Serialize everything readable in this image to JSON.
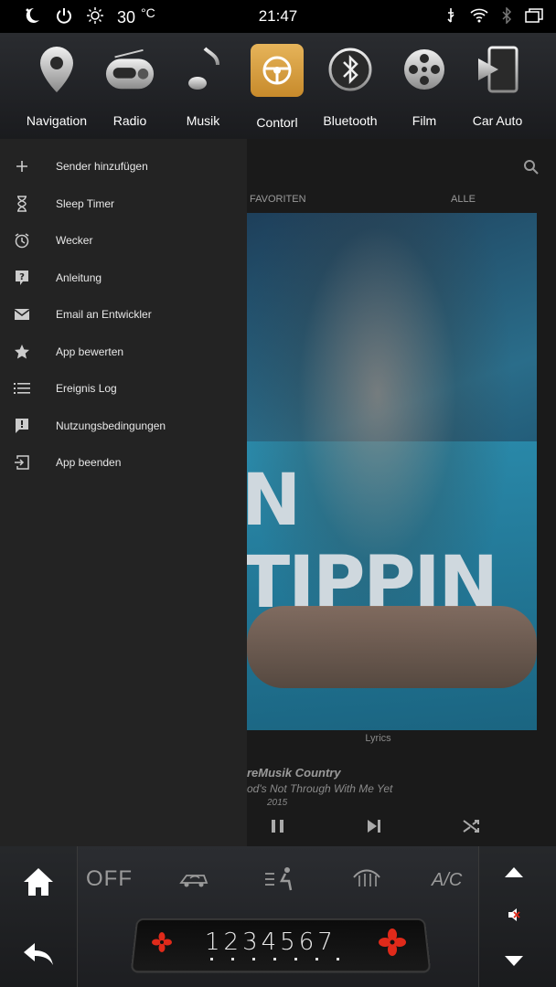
{
  "status": {
    "temperature": "30",
    "unit": "°C",
    "time": "21:47"
  },
  "dock": [
    {
      "label": "Navigation",
      "icon": "location-pin-icon"
    },
    {
      "label": "Radio",
      "icon": "radio-icon"
    },
    {
      "label": "Musik",
      "icon": "music-note-icon"
    },
    {
      "label": "Contorl",
      "icon": "steering-wheel-icon",
      "active": true
    },
    {
      "label": "Bluetooth",
      "icon": "bluetooth-icon"
    },
    {
      "label": "Film",
      "icon": "film-reel-icon"
    },
    {
      "label": "Car Auto",
      "icon": "phone-play-icon"
    }
  ],
  "tabs": {
    "favorites": "FAVORITEN",
    "all": "ALLE"
  },
  "drawer": {
    "items": [
      {
        "label": "Sender hinzufügen",
        "icon": "plus-icon"
      },
      {
        "label": "Sleep Timer",
        "icon": "hourglass-icon"
      },
      {
        "label": "Wecker",
        "icon": "alarm-icon"
      },
      {
        "label": "Anleitung",
        "icon": "help-icon"
      },
      {
        "label": "Email an Entwickler",
        "icon": "email-icon"
      },
      {
        "label": "App bewerten",
        "icon": "star-icon"
      },
      {
        "label": "Ereignis Log",
        "icon": "list-icon"
      },
      {
        "label": "Nutzungsbedingungen",
        "icon": "feedback-icon"
      },
      {
        "label": "App beenden",
        "icon": "exit-icon"
      }
    ]
  },
  "player": {
    "lyrics": "Lyrics",
    "station": "reMusik Country",
    "song": "od's Not Through With Me Yet",
    "year": "2015",
    "cover_text": "N TIPPIN"
  },
  "climate": {
    "off": "OFF",
    "ac": "A/C",
    "speeds": "1234567",
    "accent": "#e02a1a"
  }
}
